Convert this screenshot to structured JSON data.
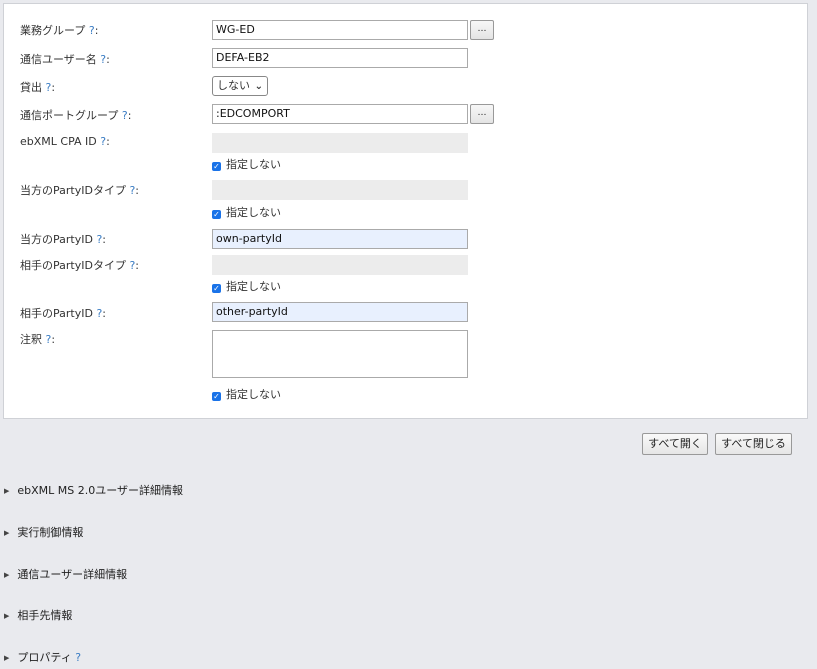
{
  "form": {
    "business_group": {
      "label": "業務グループ",
      "help": "?",
      "value": "WG-ED",
      "browse": "…"
    },
    "comm_user_name": {
      "label": "通信ユーザー名",
      "help": "?",
      "value": "DEFA-EB2"
    },
    "lending": {
      "label": "貸出",
      "help": "?",
      "selected": "しない"
    },
    "comm_port_group": {
      "label": "通信ポートグループ",
      "help": "?",
      "value": ":EDCOMPORT",
      "browse": "…"
    },
    "cpa_id": {
      "label": "ebXML CPA ID",
      "help": "?",
      "value": "",
      "unspecified": "指定しない"
    },
    "own_partyid_type": {
      "label": "当方のPartyIDタイプ",
      "help": "?",
      "value": "",
      "unspecified": "指定しない"
    },
    "own_partyid": {
      "label": "当方のPartyID",
      "help": "?",
      "value": "own-partyId"
    },
    "other_partyid_type": {
      "label": "相手のPartyIDタイプ",
      "help": "?",
      "value": "",
      "unspecified": "指定しない"
    },
    "other_partyid": {
      "label": "相手のPartyID",
      "help": "?",
      "value": "other-partyId"
    },
    "note": {
      "label": "注釈",
      "help": "?",
      "value": "",
      "unspecified": "指定しない"
    }
  },
  "actions": {
    "expand_all": "すべて開く",
    "collapse_all": "すべて閉じる"
  },
  "sections": [
    {
      "label": "ebXML MS 2.0ユーザー詳細情報"
    },
    {
      "label": "実行制御情報"
    },
    {
      "label": "通信ユーザー詳細情報"
    },
    {
      "label": "相手先情報"
    },
    {
      "label": "プロパティ",
      "help": "?"
    }
  ],
  "colors": {
    "help_link": "#3b7dc4",
    "autofill_bg": "#e8f0fe",
    "checkbox": "#1a73e8",
    "page_bg": "#e9eaee"
  }
}
